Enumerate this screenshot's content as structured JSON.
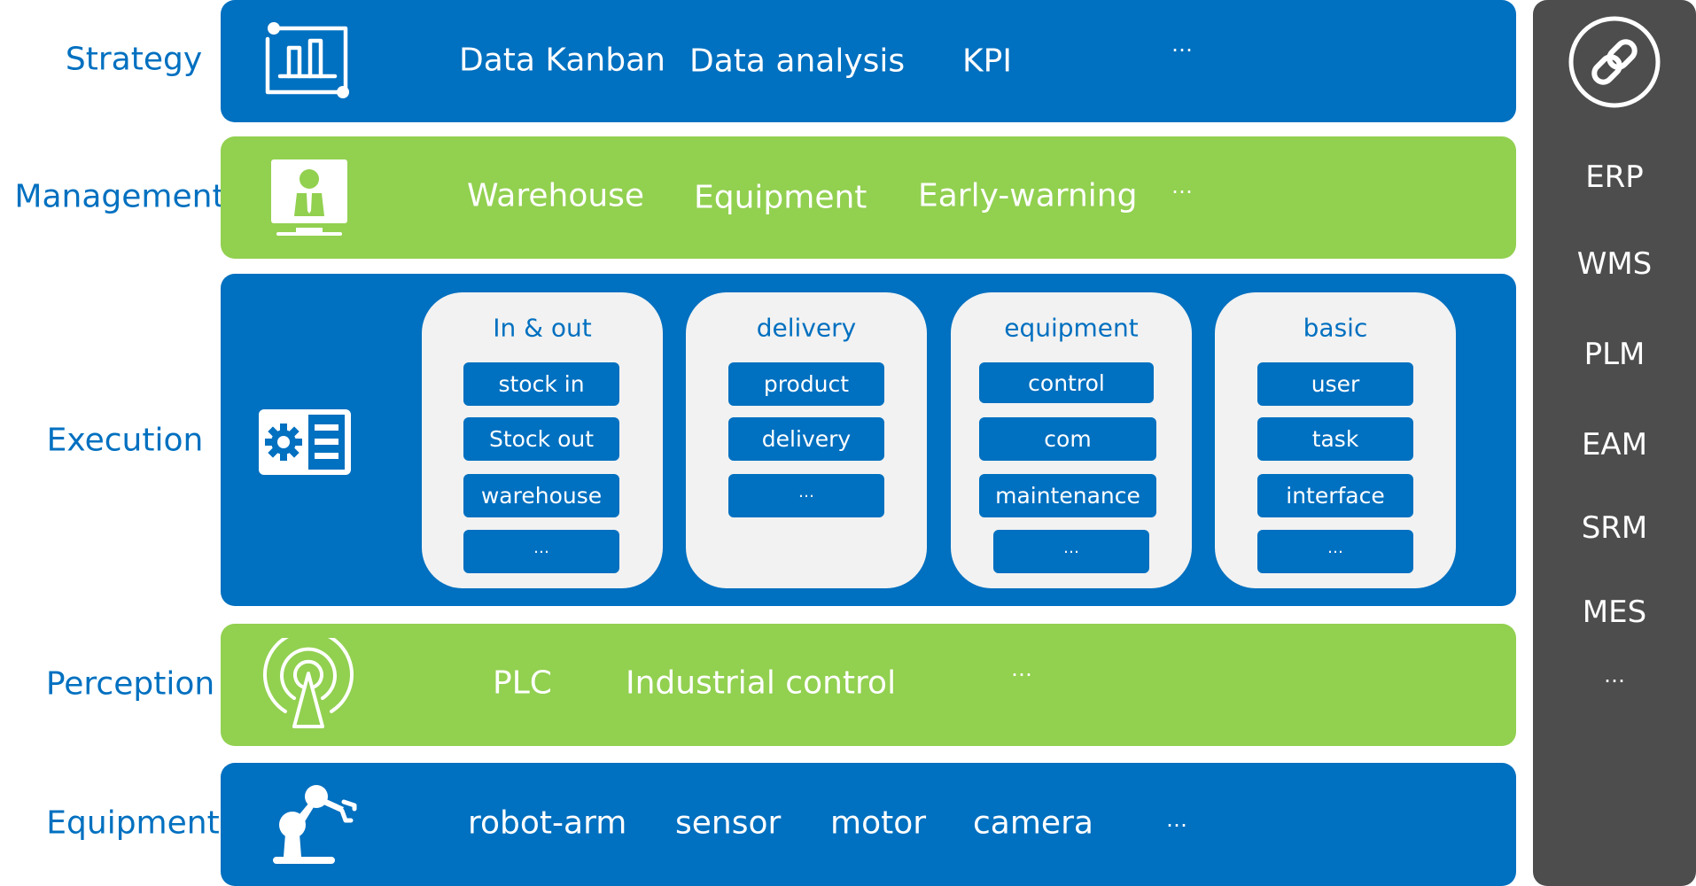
{
  "layers": {
    "strategy": {
      "label": "Strategy",
      "icon": "chart-board-icon",
      "items": [
        "Data Kanban",
        "Data analysis",
        "KPI"
      ],
      "more": "…"
    },
    "management": {
      "label": "Management",
      "icon": "manager-monitor-icon",
      "items": [
        "Warehouse",
        "Equipment",
        "Early-warning"
      ],
      "more": "…"
    },
    "execution": {
      "label": "Execution",
      "icon": "gear-list-icon",
      "cards": [
        {
          "title": "In & out",
          "buttons": [
            "stock in",
            "Stock out",
            "warehouse",
            "…"
          ]
        },
        {
          "title": "delivery",
          "buttons": [
            "product",
            "delivery",
            "…"
          ]
        },
        {
          "title": "equipment",
          "buttons": [
            "control",
            "com",
            "maintenance",
            "…"
          ]
        },
        {
          "title": "basic",
          "buttons": [
            "user",
            "task",
            "interface",
            "…"
          ]
        }
      ]
    },
    "perception": {
      "label": "Perception",
      "icon": "signal-tower-icon",
      "items": [
        "PLC",
        "Industrial control"
      ],
      "more": "…"
    },
    "equipment": {
      "label": "Equipment",
      "icon": "robot-arm-icon",
      "items": [
        "robot-arm",
        "sensor",
        "motor",
        "camera"
      ],
      "more": "…"
    }
  },
  "side_panel": {
    "icon": "link-icon",
    "items": [
      "ERP",
      "WMS",
      "PLM",
      "EAM",
      "SRM",
      "MES",
      "…"
    ]
  },
  "colors": {
    "blue": "#0070c0",
    "green": "#92d050",
    "card": "#f2f2f2",
    "side_panel": "#4d4d4d",
    "label_text": "#0070c0"
  }
}
